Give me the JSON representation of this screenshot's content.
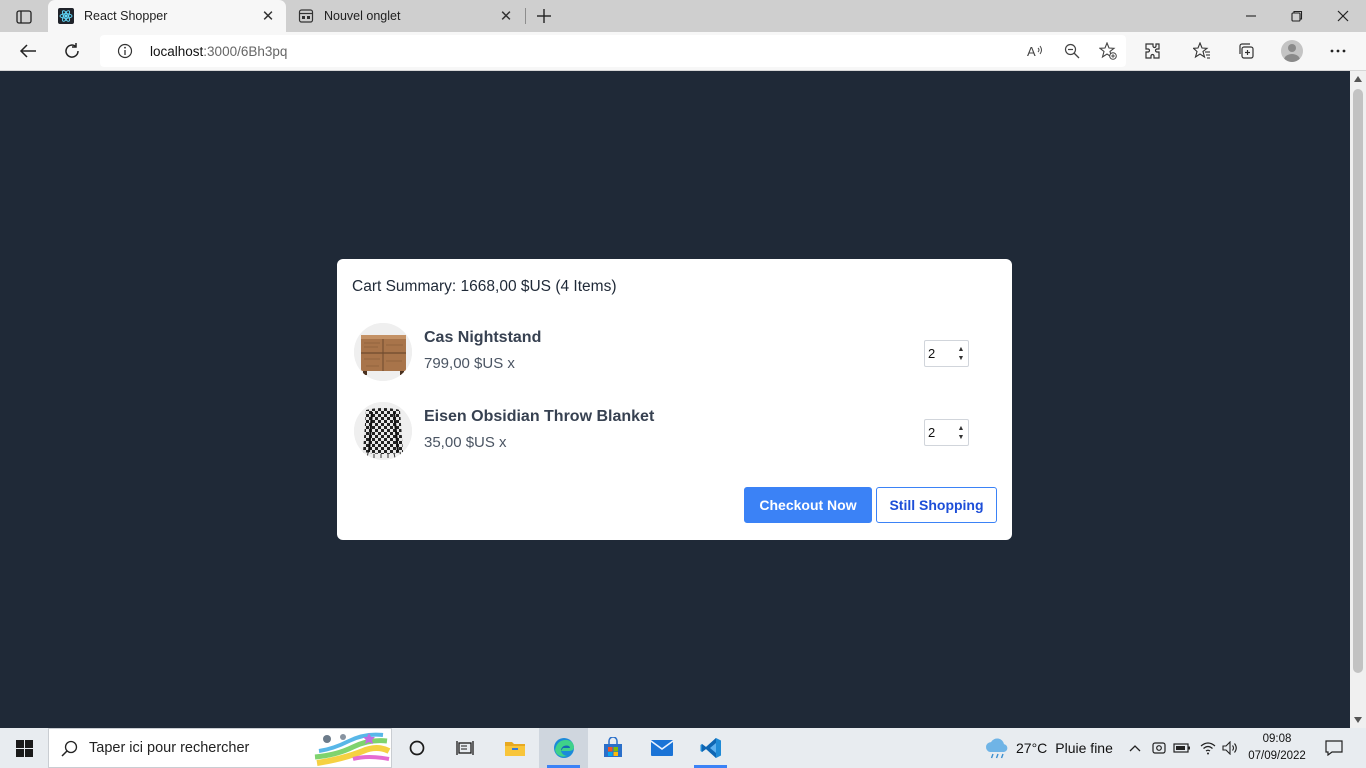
{
  "browser": {
    "tabs": [
      {
        "title": "React Shopper",
        "active": true,
        "icon": "react-logo-icon"
      },
      {
        "title": "Nouvel onglet",
        "active": false,
        "icon": "new-tab-page-icon"
      }
    ],
    "address": {
      "host": "localhost",
      "path": ":3000/6Bh3pq"
    },
    "toolbar_icons": [
      "back-icon",
      "refresh-icon",
      "site-info-icon",
      "read-aloud-icon",
      "zoom-out-icon",
      "add-favorite-icon",
      "extensions-icon",
      "favorites-icon",
      "collections-icon",
      "profile-icon",
      "more-icon"
    ],
    "window_controls": [
      "minimize-icon",
      "restore-icon",
      "close-icon"
    ]
  },
  "cart": {
    "summary_label": "Cart Summary:",
    "total": "1668,00 $US",
    "items_count": "(4 Items)",
    "items": [
      {
        "name": "Cas Nightstand",
        "price": "799,00 $US x",
        "quantity": "2",
        "image": "nightstand-image"
      },
      {
        "name": "Eisen Obsidian Throw Blanket",
        "price": "35,00 $US x",
        "quantity": "2",
        "image": "blanket-image"
      }
    ],
    "checkout_label": "Checkout Now",
    "continue_label": "Still Shopping"
  },
  "colors": {
    "page_bg": "#1f2937",
    "primary": "#3b82f6",
    "primary_text": "#1d4ed8",
    "modal_bg": "#ffffff"
  },
  "taskbar": {
    "search_placeholder": "Taper ici pour rechercher",
    "apps": [
      "cortana-icon",
      "task-view-icon",
      "file-explorer-icon",
      "edge-icon",
      "microsoft-store-icon",
      "mail-icon",
      "vscode-icon"
    ],
    "weather_temp": "27°C",
    "weather_condition": "Pluie fine",
    "time": "09:08",
    "date": "07/09/2022"
  }
}
